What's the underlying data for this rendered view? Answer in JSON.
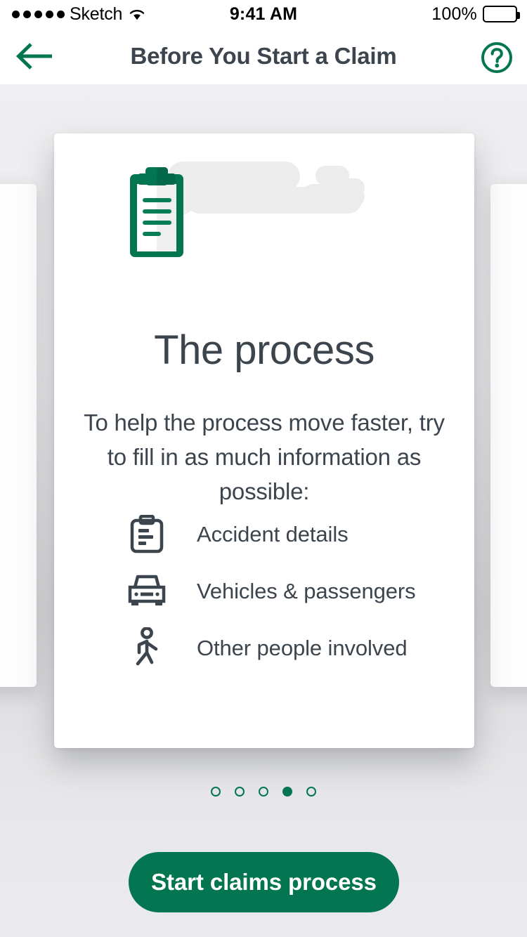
{
  "status_bar": {
    "signal_dots": 5,
    "carrier": "Sketch",
    "wifi_icon": "wifi-icon",
    "time": "9:41 AM",
    "battery_percent": "100%",
    "battery_icon": "battery-full-icon"
  },
  "nav_bar": {
    "back_icon": "arrow-left-icon",
    "title": "Before You Start a Claim",
    "help_icon": "question-mark-circle-icon"
  },
  "card": {
    "illustration_icon": "clipboard-illustration",
    "title": "The process",
    "body": "To help the process move faster, try to fill in as much information as possible:",
    "features": [
      {
        "icon": "clipboard-icon",
        "label": "Accident details"
      },
      {
        "icon": "car-front-icon",
        "label": "Vehicles & passengers"
      },
      {
        "icon": "pedestrian-icon",
        "label": "Other people involved"
      }
    ]
  },
  "pagination": {
    "total": 5,
    "active_index": 3
  },
  "primary_action": {
    "label": "Start claims process"
  },
  "colors": {
    "brand_green": "#047551",
    "text_dark": "#3c454e",
    "card_white": "#ffffff",
    "illustration_gray": "#ececec"
  }
}
